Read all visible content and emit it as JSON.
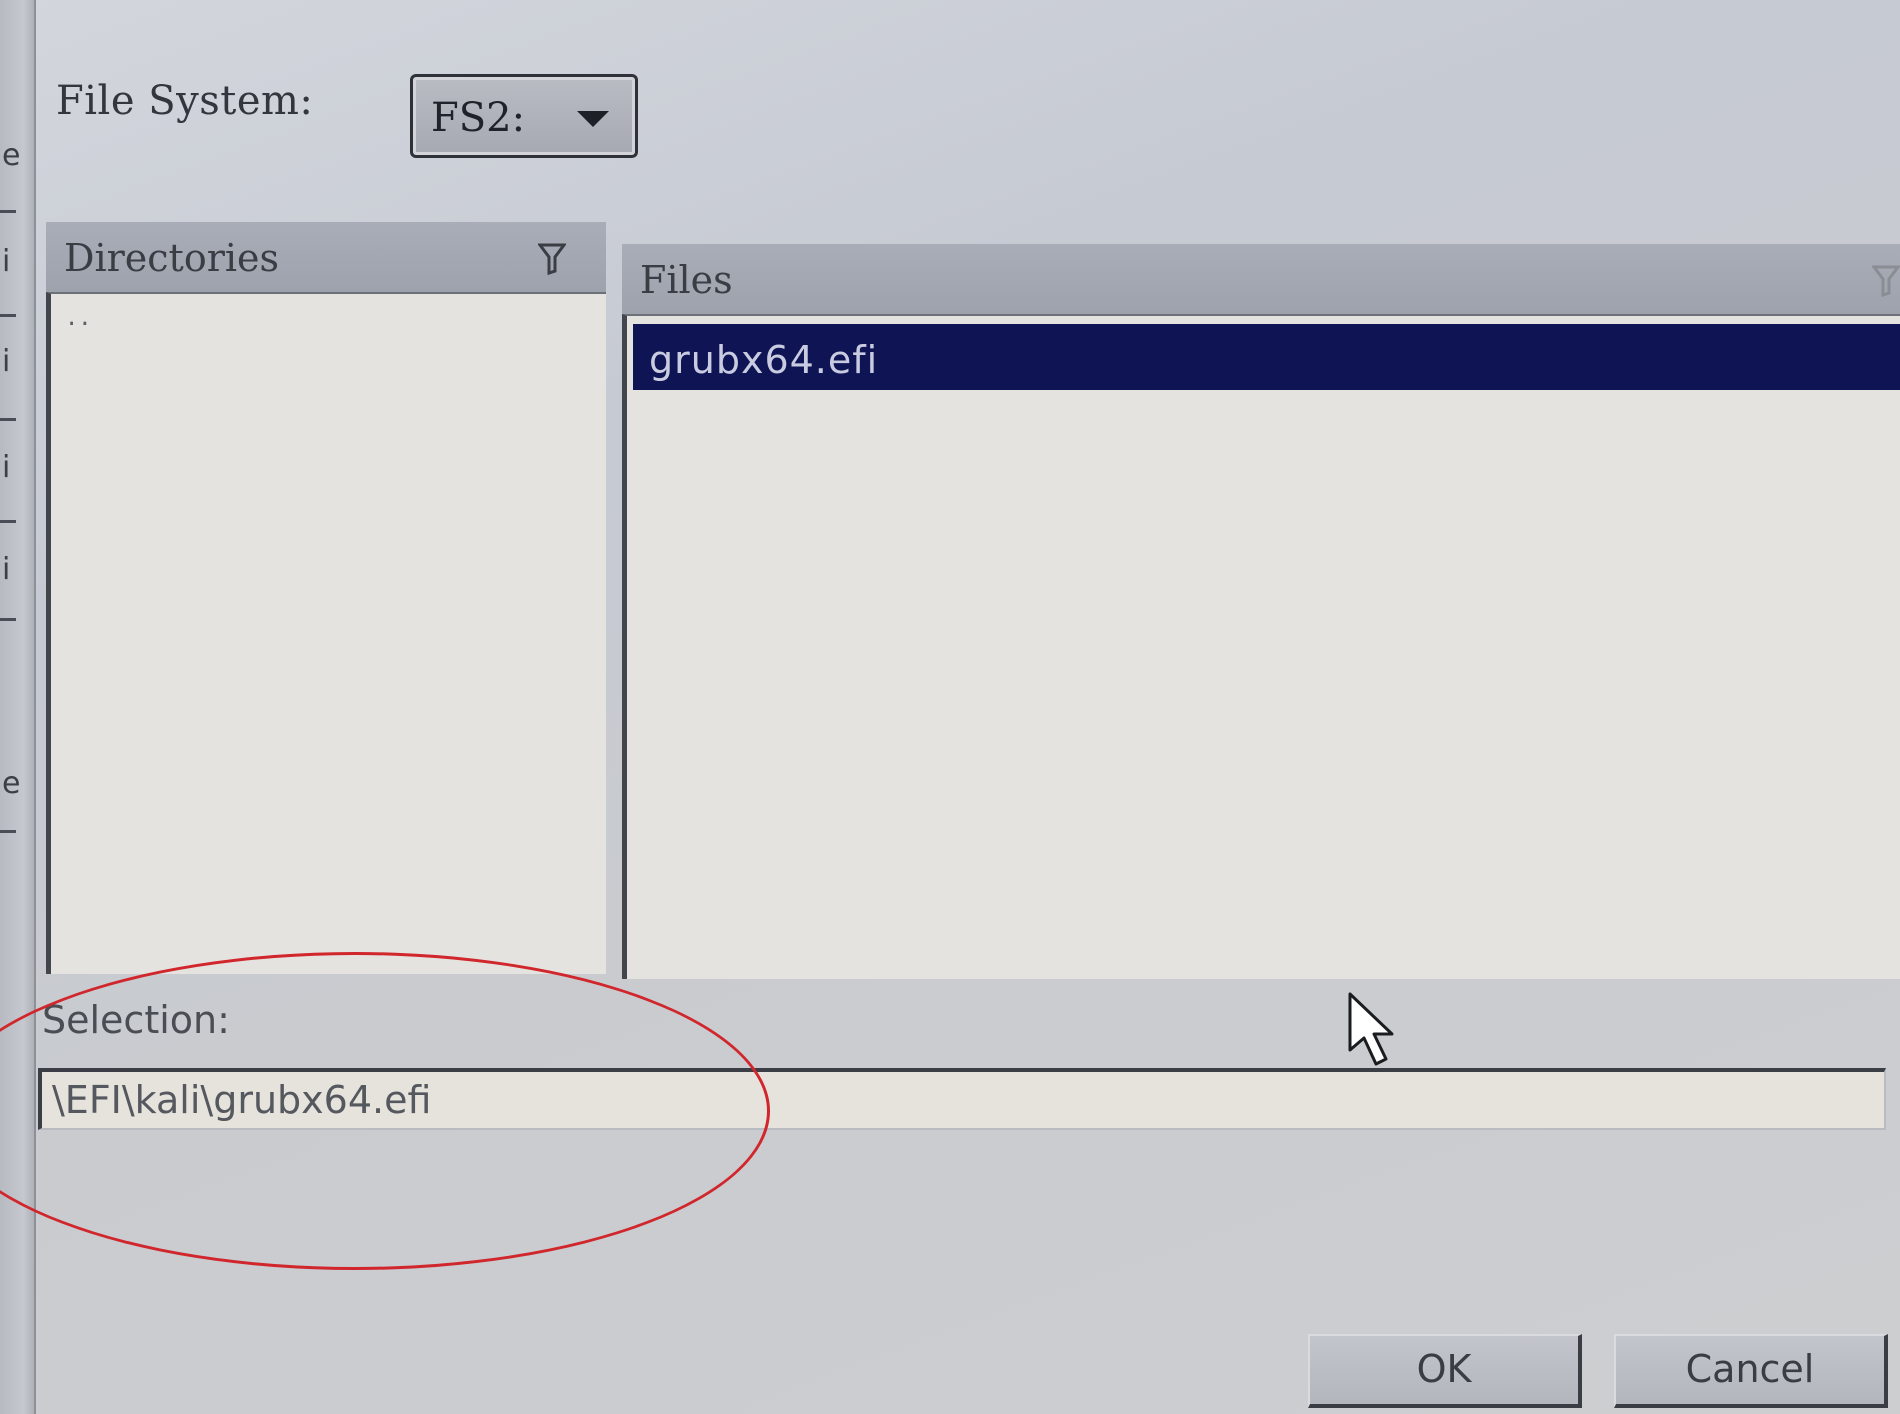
{
  "file_system": {
    "label": "File System:",
    "selected": "FS2:"
  },
  "directories": {
    "title": "Directories",
    "items": [
      ".."
    ]
  },
  "files": {
    "title": "Files",
    "items": [
      "grubx64.efi"
    ],
    "selected_index": 0
  },
  "selection": {
    "label": "Selection:",
    "value": "\\EFI\\kali\\grubx64.efi"
  },
  "buttons": {
    "ok": "OK",
    "cancel": "Cancel"
  },
  "colors": {
    "selected_row": "#0e1454",
    "annotation": "#d0262c"
  },
  "icons": {
    "filter": "filter-icon",
    "dropdown": "chevron-down-icon",
    "pointer": "mouse-pointer-icon"
  }
}
